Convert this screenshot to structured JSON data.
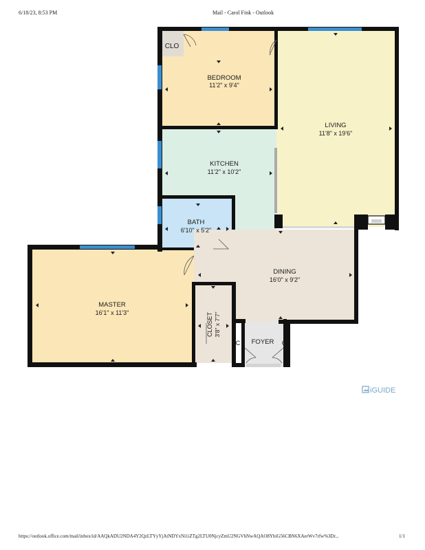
{
  "header": {
    "datetime": "6/18/23, 8:53 PM",
    "title": "Mail - Carol Fink - Outlook"
  },
  "footer": {
    "url": "https://outlook.office.com/mail/inbox/id/AAQkADU2NDA4Y2QzLTYyYjAtNDYxNi1iZTg2LTU0NjcyZmU2NGVhNwAQAO8YbiG56CBN6XAerWv7rfw%3Dr...",
    "page": "1/1"
  },
  "brand": {
    "logo_text": "iGUIDE",
    "color": "#7aa7c7"
  },
  "floorplan": {
    "rooms": {
      "bedroom": {
        "name": "BEDROOM",
        "dims": "11'2\" x 9'4\"",
        "color": "#fbe6b8"
      },
      "living": {
        "name": "LIVING",
        "dims": "11'8\" x 19'6\"",
        "color": "#f8f2c8"
      },
      "kitchen": {
        "name": "KITCHEN",
        "dims": "11'2\" x 10'2\"",
        "color": "#dcefe4"
      },
      "bath": {
        "name": "BATH",
        "dims": "6'10\" x 5'2\"",
        "color": "#c8e4f6"
      },
      "dining": {
        "name": "DINING",
        "dims": "16'0\" x 9'2\"",
        "color": "#ece4d8"
      },
      "master": {
        "name": "MASTER",
        "dims": "16'1\" x 11'3\"",
        "color": "#fbe6b8"
      },
      "closet": {
        "name": "CLOSET",
        "dims": "3'8\" x 7'7\"",
        "color": "#ece4d8"
      },
      "foyer": {
        "name": "FOYER",
        "color": "#e6e6e6"
      },
      "clo": {
        "name": "CLO",
        "color": "#e0dcd4"
      },
      "c_left": {
        "name": "C"
      },
      "c_right": {
        "name": "C"
      }
    },
    "wall_color": "#111111",
    "window_color": "#3a8fd0"
  }
}
